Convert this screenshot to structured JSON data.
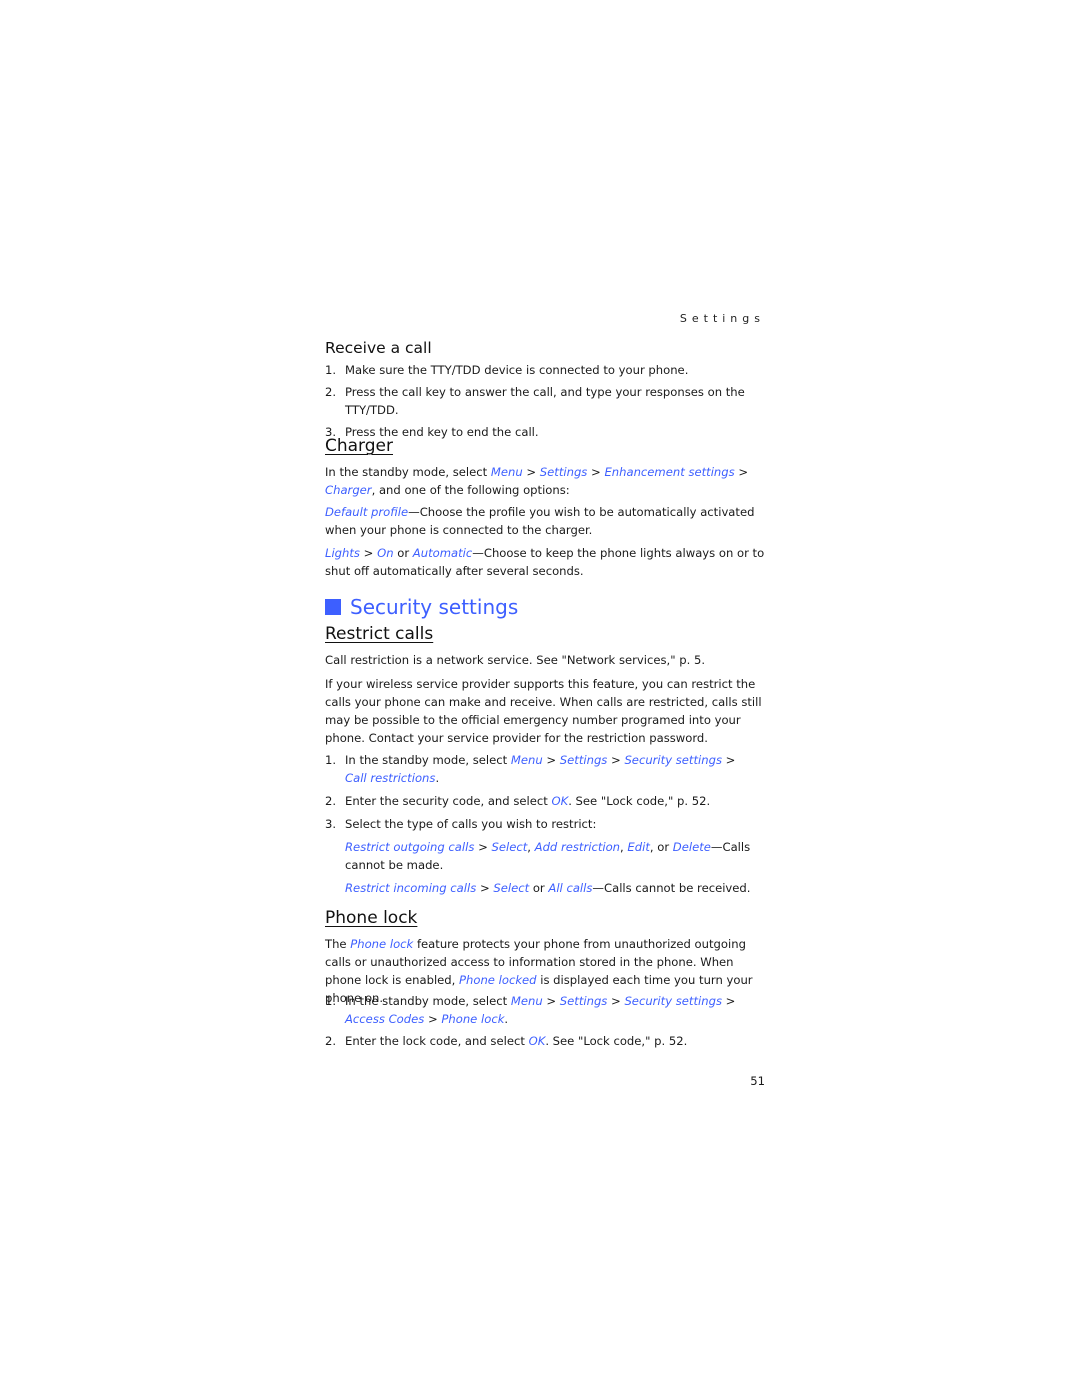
{
  "running_head": "Settings",
  "page_number": "51",
  "receive_call": {
    "heading": "Receive a call",
    "steps": [
      {
        "num": "1.",
        "text": "Make sure the TTY/TDD device is connected to your phone."
      },
      {
        "num": "2.",
        "text": "Press the call key to answer the call, and type your responses on the TTY/TDD."
      },
      {
        "num": "3.",
        "text": "Press the end key to end the call."
      }
    ]
  },
  "charger": {
    "heading": "Charger",
    "intro": {
      "pre": "In the standby mode, select ",
      "link1": "Menu",
      "sep1": " > ",
      "link2": "Settings",
      "sep2": " > ",
      "link3": "Enhancement settings",
      "sep3": " > ",
      "link4": "Charger",
      "post": ", and one of the following options:"
    },
    "option1": {
      "link": "Default profile",
      "text": "—Choose the profile you wish to be automatically activated when your phone is connected to the charger."
    },
    "option2": {
      "link1": "Lights",
      "sep1": " > ",
      "link2": "On",
      "mid": " or ",
      "link3": "Automatic",
      "text": "—Choose to keep the phone lights always on or to shut off automatically after several seconds."
    }
  },
  "security": {
    "heading": "Security settings",
    "accent_color": "#3d5fff",
    "restrict_calls": {
      "heading": "Restrict calls",
      "para1": "Call restriction is a network service. See \"Network services,\" p. 5.",
      "para2": "If your wireless service provider supports this feature, you can restrict the calls your phone can make and receive. When calls are restricted, calls still may be possible to the official emergency number programed into your phone. Contact your service provider for the restriction password.",
      "step1": {
        "num": "1.",
        "pre": "In the standby mode, select ",
        "link1": "Menu",
        "sep1": " > ",
        "link2": "Settings",
        "sep2": " > ",
        "link3": "Security settings",
        "sep3": " > ",
        "link4": "Call restrictions",
        "post": "."
      },
      "step2": {
        "num": "2.",
        "pre": "Enter the security code, and select ",
        "link": "OK",
        "post": ". See \"Lock code,\" p. 52."
      },
      "step3": {
        "num": "3.",
        "text": "Select the type of calls you wish to restrict:"
      },
      "sub1": {
        "link1": "Restrict outgoing calls",
        "sep1": " > ",
        "link2": "Select",
        "c1": ", ",
        "link3": "Add restriction",
        "c2": ", ",
        "link4": "Edit",
        "c3": ", or ",
        "link5": "Delete",
        "text": "—Calls cannot be made."
      },
      "sub2": {
        "link1": "Restrict incoming calls",
        "sep1": " > ",
        "link2": "Select",
        "mid": " or ",
        "link3": "All calls",
        "text": "—Calls cannot be received."
      }
    },
    "phone_lock": {
      "heading": "Phone lock",
      "para": {
        "pre": "The ",
        "link1": "Phone lock",
        "mid": " feature protects your phone from unauthorized outgoing calls or unauthorized access to information stored in the phone. When phone lock is enabled, ",
        "link2": "Phone locked",
        "post": " is displayed each time you turn your phone on."
      },
      "step1": {
        "num": "1.",
        "pre": "In the standby mode, select ",
        "link1": "Menu",
        "sep1": " > ",
        "link2": "Settings",
        "sep2": " > ",
        "link3": "Security settings",
        "sep3": " > ",
        "link4": "Access Codes",
        "sep4": " > ",
        "link5": "Phone lock",
        "post": "."
      },
      "step2": {
        "num": "2.",
        "pre": "Enter the lock code, and select ",
        "link": "OK",
        "post": ". See \"Lock code,\" p. 52."
      }
    }
  }
}
